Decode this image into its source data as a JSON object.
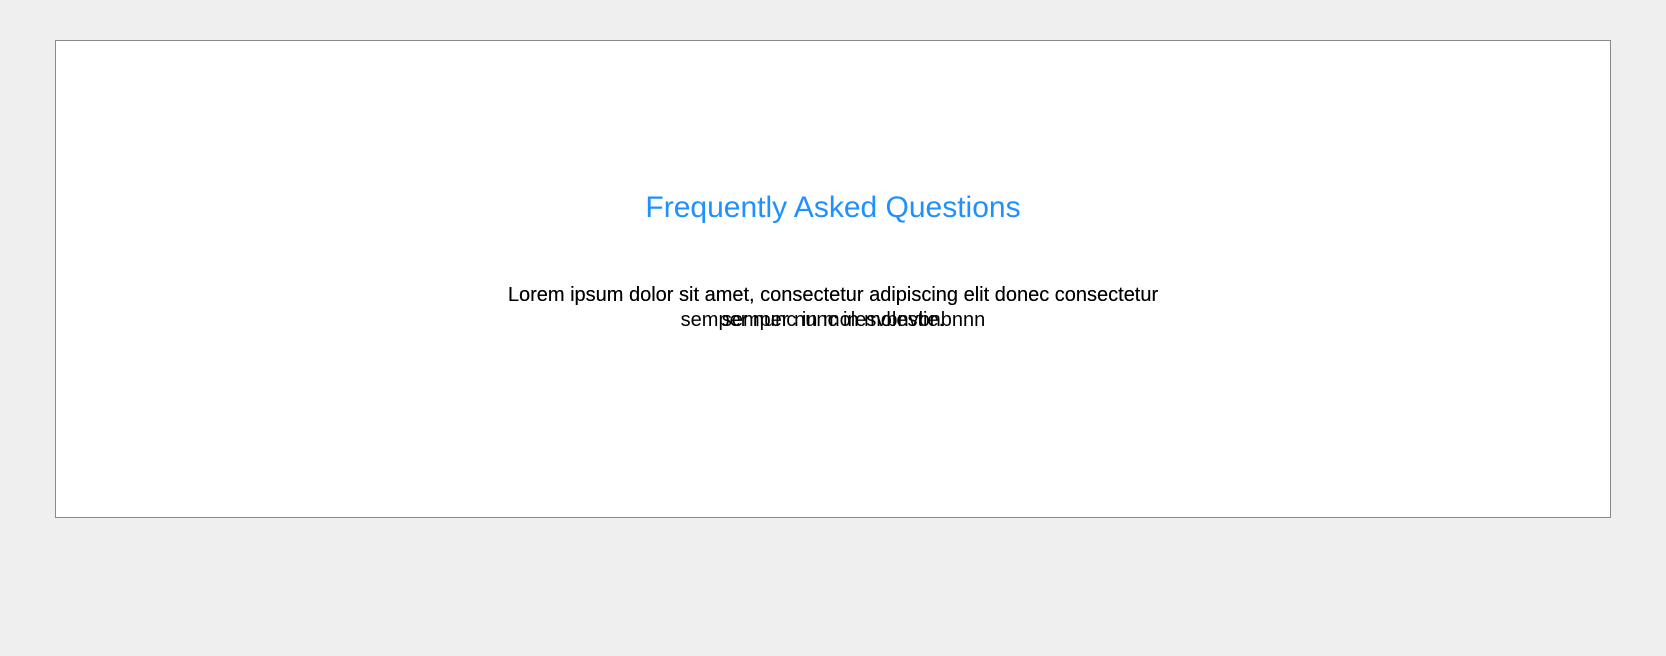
{
  "faq": {
    "heading": "Frequently Asked Questions",
    "description_base": "Lorem ipsum dolor sit amet, consectetur adipiscing elit donec consectetur semper nunc in molestie.",
    "description_overlay": "Lorem ipsum dolor sit amet, consectetur adipiscing elit donec consectetur semper nunc in molesvbnvbnbnnn"
  }
}
